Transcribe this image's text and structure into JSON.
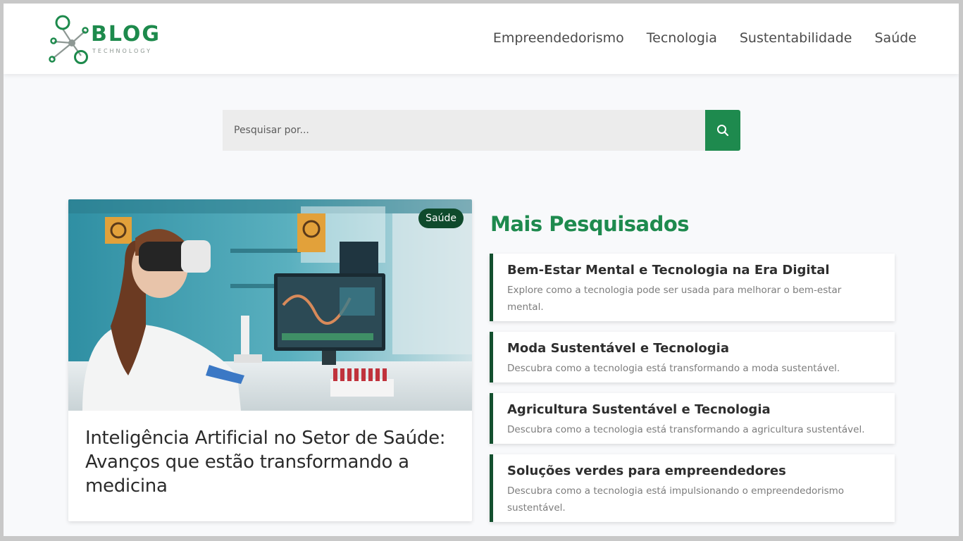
{
  "header": {
    "logo_word": "BLOG",
    "logo_sub": "TECHNOLOGY",
    "nav": [
      "Empreendedorismo",
      "Tecnologia",
      "Sustentabilidade",
      "Saúde"
    ]
  },
  "search": {
    "placeholder": "Pesquisar por...",
    "icon": "search-icon"
  },
  "featured": {
    "category": "Saúde",
    "title": "Inteligência Artificial no Setor de Saúde: Avanços que estão transformando a medicina"
  },
  "most_searched": {
    "heading": "Mais Pesquisados",
    "items": [
      {
        "title": "Bem-Estar Mental e Tecnologia na Era Digital",
        "desc": "Explore como a tecnologia pode ser usada para melhorar o bem-estar mental."
      },
      {
        "title": "Moda Sustentável e Tecnologia",
        "desc": "Descubra como a tecnologia está transformando a moda sustentável."
      },
      {
        "title": "Agricultura Sustentável e Tecnologia",
        "desc": "Descubra como a tecnologia está transformando a agricultura sustentável."
      },
      {
        "title": "Soluções verdes para empreendedores",
        "desc": "Descubra como a tecnologia está impulsionando o empreendedorismo sustentável."
      }
    ]
  },
  "colors": {
    "brand_green": "#1e8a4e",
    "dark_green": "#14502f"
  }
}
